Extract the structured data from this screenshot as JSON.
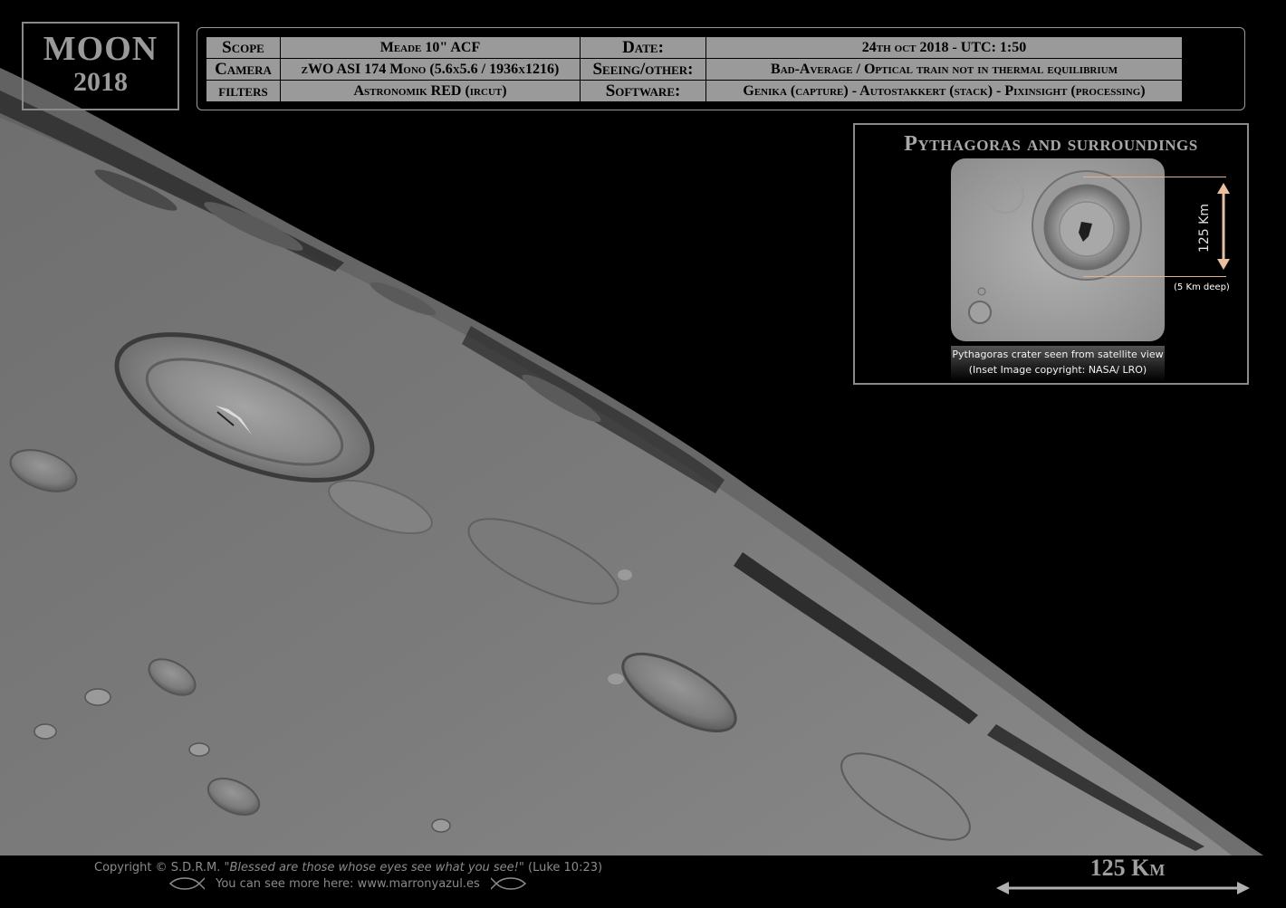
{
  "title": {
    "main": "MOON",
    "year": "2018"
  },
  "info": {
    "scope_label": "Scope",
    "scope_value": "Meade 10\" ACF",
    "date_label": "Date:",
    "date_value": "24th oct 2018 - UTC: 1:50",
    "camera_label": "Camera",
    "camera_value": "zWO ASI 174 Mono (5.6x5.6 / 1936x1216)",
    "seeing_label": "Seeing/other:",
    "seeing_value": "Bad-Average / Optical train not in thermal equilibrium",
    "filters_label": "filters",
    "filters_value": "Astronomik RED (ircut)",
    "software_label": "Software:",
    "software_value": "Genika (capture) - Autostakkert (stack) - Pixinsight (processing)"
  },
  "inset": {
    "title": "Pythagoras and surroundings",
    "measure_label": "125 Km",
    "depth_label": "(5 Km deep)",
    "caption_line1": "Pythagoras crater seen from satellite view",
    "caption_line2": "(Inset Image copyright: NASA/ LRO)"
  },
  "footer": {
    "copyright_prefix": "Copyright © S.D.R.M.",
    "quote": "\"Blessed are those whose eyes see what you see!\"",
    "reference": "(Luke 10:23)",
    "website": "You can see more here: www.marronyazul.es"
  },
  "scale": {
    "label": "125 Km"
  },
  "colors": {
    "background": "#000000",
    "panel_grey": "#9a9a9a",
    "measure_accent": "#e0b090",
    "lunar_surface": "#7d7d7d"
  }
}
